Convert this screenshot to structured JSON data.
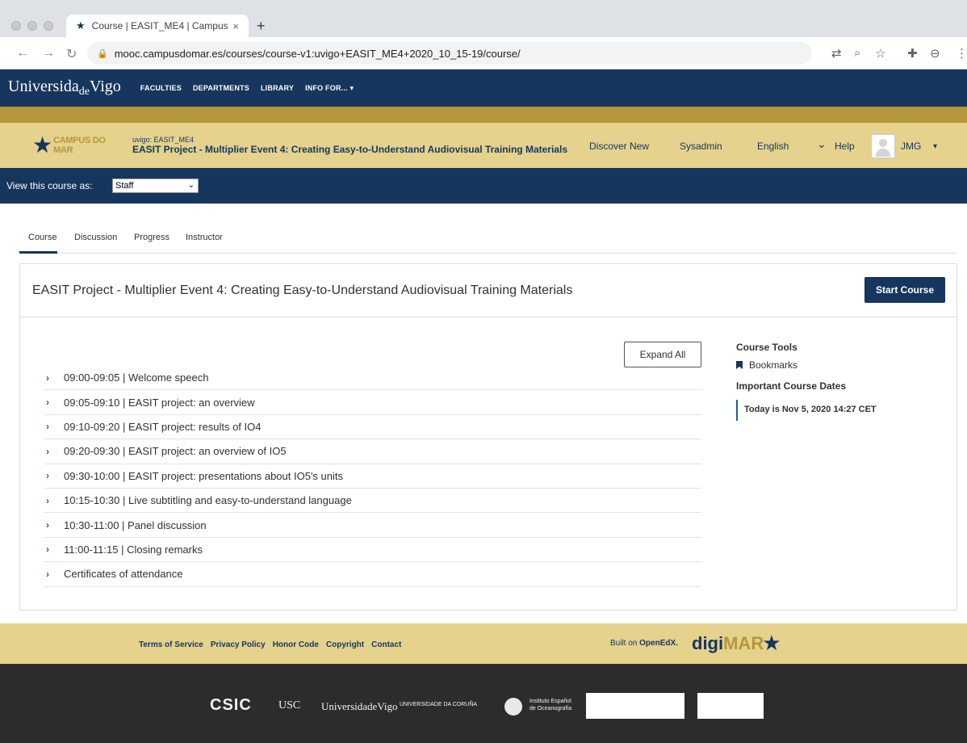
{
  "browser": {
    "tab_title": "Course | EASIT_ME4 | Campus",
    "tab_close": "×",
    "new_tab": "+",
    "url": "mooc.campusdomar.es/courses/course-v1:uvigo+EASIT_ME4+2020_10_15-19/course/"
  },
  "university": {
    "logo_main": "Universida",
    "logo_de": "de",
    "logo_end": "Vigo",
    "nav": [
      "FACULTIES",
      "DEPARTMENTS",
      "LIBRARY",
      "INFO FOR... ▾"
    ]
  },
  "course_header": {
    "brand": "CAMPUS DO MAR",
    "org": "uvigo: EASIT_ME4",
    "course_name": "EASIT Project - Multiplier Event 4: Creating Easy-to-Understand Audiovisual Training Materials",
    "discover": "Discover New",
    "sysadmin": "Sysadmin",
    "language": "English",
    "language_caret": "⌄",
    "help": "Help",
    "user": "JMG",
    "user_caret": "▾"
  },
  "staff_bar": {
    "label": "View this course as:",
    "selected": "Staff"
  },
  "tabs": [
    "Course",
    "Discussion",
    "Progress",
    "Instructor"
  ],
  "course": {
    "title": "EASIT Project - Multiplier Event 4: Creating Easy-to-Understand Audiovisual Training Materials",
    "start_button": "Start Course",
    "expand_button": "Expand All",
    "sections": [
      "09:00-09:05 | Welcome speech",
      "09:05-09:10 | EASIT project: an overview",
      "09:10-09:20 | EASIT project: results of IO4",
      "09:20-09:30 | EASIT project: an overview of IO5",
      "09:30-10:00 | EASIT project: presentations about IO5's units",
      "10:15-10:30 | Live subtitling and easy-to-understand language",
      "10:30-11:00 | Panel discussion",
      "11:00-11:15 | Closing remarks",
      "Certificates of attendance"
    ],
    "chevron": "›"
  },
  "tools": {
    "title": "Course Tools",
    "bookmarks": "Bookmarks",
    "dates_title": "Important Course Dates",
    "today": "Today is Nov 5, 2020 14:27 CET"
  },
  "footer": {
    "links": [
      "Terms of Service",
      "Privacy Policy",
      "Honor Code",
      "Copyright",
      "Contact"
    ],
    "built_on": "Built on",
    "openedx": "OpenEdX.",
    "digi": "digi",
    "mar": "MAR",
    "partners": {
      "csic": "CSIC",
      "usc": "USC",
      "uvigo": "UniversidadeVigo",
      "udc": "UNIVERSIDADE DA CORUÑA",
      "ieo": "Instituto Español de Oceanografía"
    }
  },
  "colors": {
    "navy": "#16365d",
    "gold": "#b6963a",
    "sand": "#e4d28d"
  }
}
